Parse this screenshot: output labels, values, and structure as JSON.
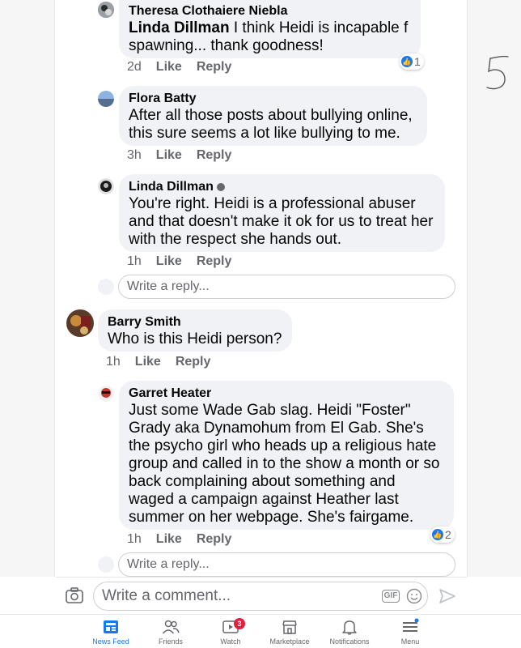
{
  "colors": {
    "accent": "#1877f2",
    "bubble": "#f0f2f5",
    "meta": "#65676b",
    "badge": "#e41e3f"
  },
  "comments": [
    {
      "author": "Theresa Clothaiere Niebla",
      "mention": "Linda Dillman",
      "text": " I think Heidi is incapable f spawning... thank goodness!",
      "time": "2d",
      "like_label": "Like",
      "reply_label": "Reply",
      "reaction_count": "1"
    },
    {
      "author": "Flora Batty",
      "text": "After all those posts about bullying online, this sure seems a lot like bullying to me.",
      "time": "3h",
      "like_label": "Like",
      "reply_label": "Reply"
    },
    {
      "author": "Linda Dillman",
      "text": "You're right. Heidi is a professional abuser and that doesn't make it ok for us to treat her with the respect she hands out.",
      "time": "1h",
      "like_label": "Like",
      "reply_label": "Reply"
    },
    {
      "author": "Barry Smith",
      "text": "Who is this Heidi person?",
      "time": "1h",
      "like_label": "Like",
      "reply_label": "Reply"
    },
    {
      "author": "Garret Heater",
      "text": "Just some Wade Gab slag. Heidi \"Foster\" Grady aka Dynamohum from El Gab. She's the psycho girl who heads up a religious hate group and called in to the show a month or so back complaining about something and waged a campaign against Heather last summer on her webpage. She's fairgame.",
      "time": "1h",
      "like_label": "Like",
      "reply_label": "Reply",
      "reaction_count": "2"
    }
  ],
  "reply_placeholder": "Write a reply...",
  "composer": {
    "placeholder": "Write a comment...",
    "gif_label": "GIF"
  },
  "tabs": [
    {
      "label": "News Feed",
      "icon": "news-feed-icon"
    },
    {
      "label": "Friends",
      "icon": "friends-icon"
    },
    {
      "label": "Watch",
      "icon": "watch-icon",
      "badge": "3"
    },
    {
      "label": "Marketplace",
      "icon": "marketplace-icon"
    },
    {
      "label": "Notifications",
      "icon": "bell-icon"
    },
    {
      "label": "Menu",
      "icon": "menu-icon"
    }
  ]
}
